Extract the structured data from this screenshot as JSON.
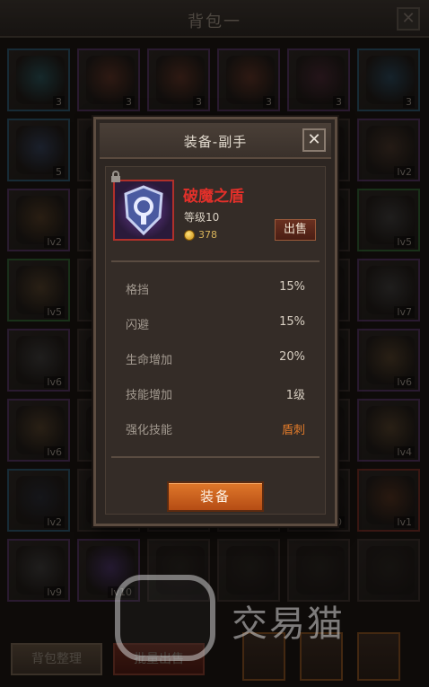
{
  "header": {
    "title": "背包一",
    "close_label": "✕"
  },
  "inventory": {
    "slots": [
      {
        "count": "3",
        "quality": "blue",
        "color": "#2b6d78"
      },
      {
        "count": "3",
        "quality": "purple",
        "color": "#7a3b28"
      },
      {
        "count": "3",
        "quality": "purple",
        "color": "#7a3b28"
      },
      {
        "count": "3",
        "quality": "purple",
        "color": "#7a3b28"
      },
      {
        "count": "3",
        "quality": "purple",
        "color": "#5a2b3e"
      },
      {
        "count": "3",
        "quality": "blue",
        "color": "#2b5a78"
      },
      {
        "count": "5",
        "quality": "blue",
        "color": "#3a5078"
      },
      {
        "count": "",
        "quality": "none",
        "color": "#3a2f2a"
      },
      {
        "count": "",
        "quality": "none",
        "color": "#3a2f2a"
      },
      {
        "count": "",
        "quality": "none",
        "color": "#3a2f2a"
      },
      {
        "count": "",
        "quality": "none",
        "color": "#3a2f2a"
      },
      {
        "count": "lv2",
        "quality": "purple",
        "color": "#5a4030"
      },
      {
        "count": "lv2",
        "quality": "purple",
        "color": "#6a4a28"
      },
      {
        "count": "",
        "quality": "none",
        "color": "#3a2f2a"
      },
      {
        "count": "",
        "quality": "none",
        "color": "#3a2f2a"
      },
      {
        "count": "",
        "quality": "none",
        "color": "#3a2f2a"
      },
      {
        "count": "",
        "quality": "none",
        "color": "#3a2f2a"
      },
      {
        "count": "lv5",
        "quality": "green",
        "color": "#4a4a4a"
      },
      {
        "count": "lv5",
        "quality": "green",
        "color": "#6a5030"
      },
      {
        "count": "",
        "quality": "none",
        "color": "#3a2f2a"
      },
      {
        "count": "",
        "quality": "none",
        "color": "#3a2f2a"
      },
      {
        "count": "",
        "quality": "none",
        "color": "#3a2f2a"
      },
      {
        "count": "",
        "quality": "none",
        "color": "#3a2f2a"
      },
      {
        "count": "lv7",
        "quality": "purple",
        "color": "#4a4a4a"
      },
      {
        "count": "lv6",
        "quality": "purple",
        "color": "#4a4a4a"
      },
      {
        "count": "",
        "quality": "none",
        "color": "#3a2f2a"
      },
      {
        "count": "",
        "quality": "none",
        "color": "#3a2f2a"
      },
      {
        "count": "",
        "quality": "none",
        "color": "#3a2f2a"
      },
      {
        "count": "",
        "quality": "none",
        "color": "#3a2f2a"
      },
      {
        "count": "lv6",
        "quality": "purple",
        "color": "#6a5030"
      },
      {
        "count": "lv6",
        "quality": "purple",
        "color": "#6a5030"
      },
      {
        "count": "",
        "quality": "none",
        "color": "#3a2f2a"
      },
      {
        "count": "",
        "quality": "none",
        "color": "#3a2f2a"
      },
      {
        "count": "",
        "quality": "none",
        "color": "#3a2f2a"
      },
      {
        "count": "",
        "quality": "none",
        "color": "#3a2f2a"
      },
      {
        "count": "lv4",
        "quality": "purple",
        "color": "#6a5030"
      },
      {
        "count": "lv2",
        "quality": "blue",
        "color": "#2a3040"
      },
      {
        "count": "",
        "quality": "none",
        "color": "#3a2f2a"
      },
      {
        "count": "",
        "quality": "none",
        "color": "#3a2f2a"
      },
      {
        "count": "",
        "quality": "none",
        "color": "#3a2f2a"
      },
      {
        "count": "0",
        "quality": "none",
        "color": "#3a2f2a"
      },
      {
        "count": "lv1",
        "quality": "red",
        "color": "#6a3a20"
      },
      {
        "count": "lv9",
        "quality": "purple",
        "color": "#4a4a4a"
      },
      {
        "count": "lv10",
        "quality": "purple",
        "color": "#5a3a8a"
      },
      {
        "count": "",
        "quality": "none",
        "color": "#2a2420"
      },
      {
        "count": "",
        "quality": "none",
        "color": "#2a2420"
      },
      {
        "count": "",
        "quality": "none",
        "color": "#2a2420"
      },
      {
        "count": "",
        "quality": "none",
        "color": "#2a2420"
      }
    ]
  },
  "modal": {
    "title": "装备-副手",
    "close_label": "✕",
    "item_name": "破魔之盾",
    "item_level": "等级10",
    "price": "378",
    "sell_label": "出售",
    "stats": [
      {
        "label": "格挡",
        "value": "15%"
      },
      {
        "label": "闪避",
        "value": "15%"
      },
      {
        "label": "生命增加",
        "value": "20%"
      },
      {
        "label": "技能增加",
        "value": "1级"
      },
      {
        "label": "强化技能",
        "value": "盾刺"
      }
    ],
    "equip_label": "装备"
  },
  "footer": {
    "sort_label": "背包整理",
    "batch_sell_label": "批量出售"
  },
  "watermark": {
    "text": "交易猫"
  },
  "colors": {
    "item_name": "#e3302a",
    "equip_button": "#d0641e",
    "highlight_value": "#e07a2a"
  }
}
